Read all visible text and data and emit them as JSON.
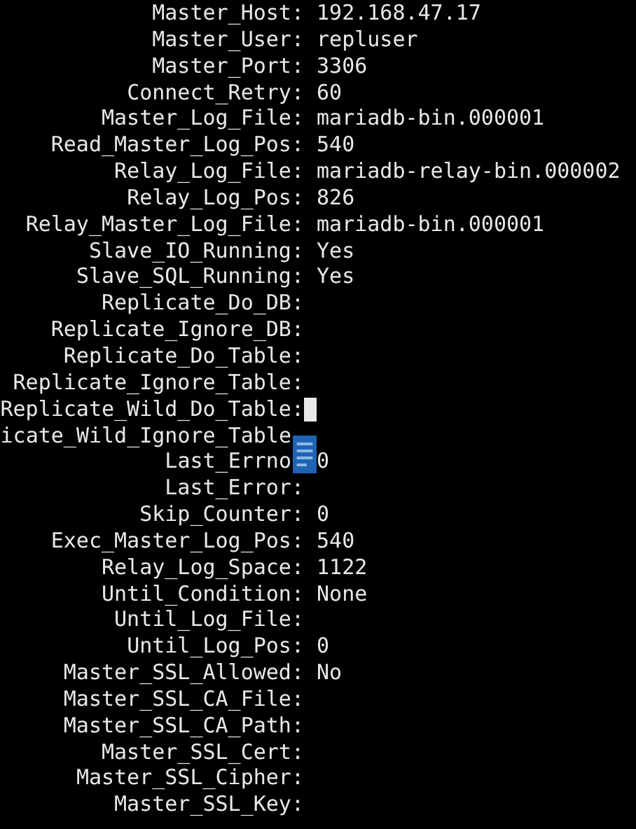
{
  "rows": [
    {
      "key": "Master_Host:",
      "value": "192.168.47.17"
    },
    {
      "key": "Master_User:",
      "value": "repluser"
    },
    {
      "key": "Master_Port:",
      "value": "3306"
    },
    {
      "key": "Connect_Retry:",
      "value": "60"
    },
    {
      "key": "Master_Log_File:",
      "value": "mariadb-bin.000001"
    },
    {
      "key": "Read_Master_Log_Pos:",
      "value": "540"
    },
    {
      "key": "Relay_Log_File:",
      "value": "mariadb-relay-bin.000002"
    },
    {
      "key": "Relay_Log_Pos:",
      "value": "826"
    },
    {
      "key": "Relay_Master_Log_File:",
      "value": "mariadb-bin.000001"
    },
    {
      "key": "Slave_IO_Running:",
      "value": "Yes"
    },
    {
      "key": "Slave_SQL_Running:",
      "value": "Yes"
    },
    {
      "key": "Replicate_Do_DB:"
    },
    {
      "key": "Replicate_Ignore_DB:"
    },
    {
      "key": "Replicate_Do_Table:"
    },
    {
      "key": "Replicate_Ignore_Table:"
    },
    {
      "key": "Replicate_Wild_Do_Table:",
      "cursor": true
    },
    {
      "key": "icate_Wild_Ignore_Table",
      "colon_hidden": true,
      "overlay_icon": true
    },
    {
      "key": "Last_Errno",
      "value": "0",
      "colon_hidden": true
    },
    {
      "key": "Last_Error:"
    },
    {
      "key": "Skip_Counter:",
      "value": "0"
    },
    {
      "key": "Exec_Master_Log_Pos:",
      "value": "540"
    },
    {
      "key": "Relay_Log_Space:",
      "value": "1122"
    },
    {
      "key": "Until_Condition:",
      "value": "None"
    },
    {
      "key": "Until_Log_File:"
    },
    {
      "key": "Until_Log_Pos:",
      "value": "0"
    },
    {
      "key": "Master_SSL_Allowed:",
      "value": "No"
    },
    {
      "key": "Master_SSL_CA_File:"
    },
    {
      "key": "Master_SSL_CA_Path:"
    },
    {
      "key": "Master_SSL_Cert:"
    },
    {
      "key": "Master_SSL_Cipher:"
    },
    {
      "key": "Master_SSL_Key:"
    }
  ]
}
